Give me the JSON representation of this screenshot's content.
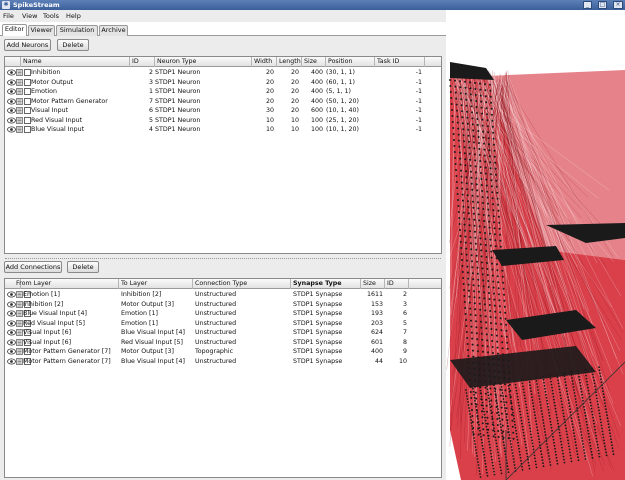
{
  "window": {
    "title": "SpikeStream"
  },
  "menu": [
    "File",
    "View",
    "Tools",
    "Help"
  ],
  "tabs": [
    "Editor",
    "Viewer",
    "Simulation",
    "Archive"
  ],
  "neurons": {
    "add_label": "Add Neurons",
    "delete_label": "Delete",
    "columns": [
      "Name",
      "ID",
      "Neuron Type",
      "Width",
      "Length",
      "Size",
      "Position",
      "Task ID"
    ],
    "rows": [
      {
        "name": "Inhibition",
        "id": "2",
        "type": "STDP1 Neuron",
        "width": "20",
        "length": "20",
        "size": "400",
        "position": "(30, 1, 1)",
        "task": "-1"
      },
      {
        "name": "Motor Output",
        "id": "3",
        "type": "STDP1 Neuron",
        "width": "20",
        "length": "20",
        "size": "400",
        "position": "(60, 1, 1)",
        "task": "-1"
      },
      {
        "name": "Emotion",
        "id": "1",
        "type": "STDP1 Neuron",
        "width": "20",
        "length": "20",
        "size": "400",
        "position": "(5, 1, 1)",
        "task": "-1"
      },
      {
        "name": "Motor Pattern Generator",
        "id": "7",
        "type": "STDP1 Neuron",
        "width": "20",
        "length": "20",
        "size": "400",
        "position": "(50, 1, 20)",
        "task": "-1"
      },
      {
        "name": "Visual Input",
        "id": "6",
        "type": "STDP1 Neuron",
        "width": "30",
        "length": "20",
        "size": "600",
        "position": "(10, 1, 40)",
        "task": "-1"
      },
      {
        "name": "Red Visual Input",
        "id": "5",
        "type": "STDP1 Neuron",
        "width": "10",
        "length": "10",
        "size": "100",
        "position": "(25, 1, 20)",
        "task": "-1"
      },
      {
        "name": "Blue Visual Input",
        "id": "4",
        "type": "STDP1 Neuron",
        "width": "10",
        "length": "10",
        "size": "100",
        "position": "(10, 1, 20)",
        "task": "-1"
      }
    ]
  },
  "connections": {
    "add_label": "Add Connections",
    "delete_label": "Delete",
    "columns": [
      "From Layer",
      "To Layer",
      "Connection Type",
      "Synapse Type",
      "Size",
      "ID"
    ],
    "rows": [
      {
        "from": "Emotion [1]",
        "to": "Inhibition [2]",
        "type": "Unstructured",
        "synapse": "STDP1 Synapse",
        "size": "1611",
        "id": "2"
      },
      {
        "from": "Inhibition [2]",
        "to": "Motor Output [3]",
        "type": "Unstructured",
        "synapse": "STDP1 Synapse",
        "size": "153",
        "id": "3"
      },
      {
        "from": "Blue Visual Input [4]",
        "to": "Emotion [1]",
        "type": "Unstructured",
        "synapse": "STDP1 Synapse",
        "size": "193",
        "id": "6"
      },
      {
        "from": "Red Visual Input [5]",
        "to": "Emotion [1]",
        "type": "Unstructured",
        "synapse": "STDP1 Synapse",
        "size": "203",
        "id": "5"
      },
      {
        "from": "Visual Input [6]",
        "to": "Blue Visual Input [4]",
        "type": "Unstructured",
        "synapse": "STDP1 Synapse",
        "size": "624",
        "id": "7"
      },
      {
        "from": "Visual Input [6]",
        "to": "Red Visual Input [5]",
        "type": "Unstructured",
        "synapse": "STDP1 Synapse",
        "size": "601",
        "id": "8"
      },
      {
        "from": "Motor Pattern Generator [7]",
        "to": "Motor Output [3]",
        "type": "Topographic",
        "synapse": "STDP1 Synapse",
        "size": "400",
        "id": "9"
      },
      {
        "from": "Motor Pattern Generator [7]",
        "to": "Blue Visual Input [4]",
        "type": "Unstructured",
        "synapse": "STDP1 Synapse",
        "size": "44",
        "id": "10"
      }
    ]
  },
  "colors": {
    "titlebar": "#3b5f99",
    "connection_red": "#d21e2a",
    "neuron_dot": "#1a1a1a",
    "background": "#ececec"
  },
  "icons": {
    "app": "app-icon",
    "minimize": "minimize-icon",
    "maximize": "maximize-icon",
    "close": "close-icon",
    "visibility": "eye-icon",
    "parameters": "parameters-icon"
  }
}
